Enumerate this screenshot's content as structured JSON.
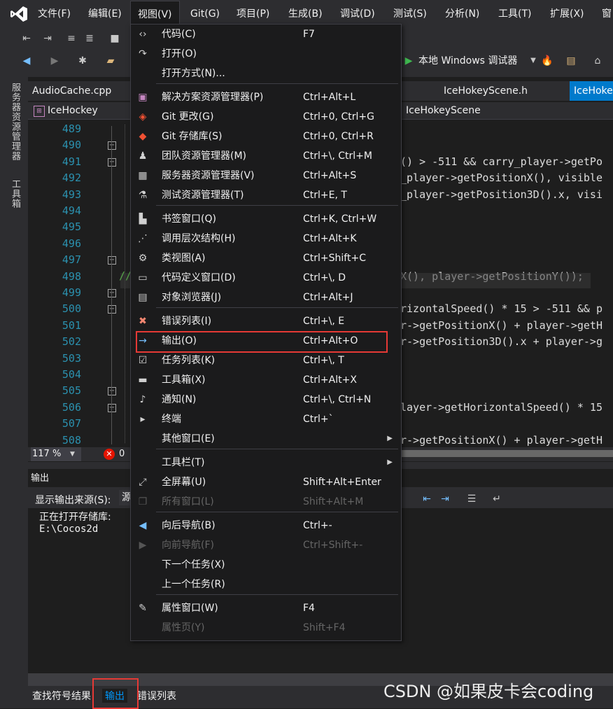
{
  "menubar": {
    "items": [
      "文件(F)",
      "编辑(E)",
      "视图(V)",
      "Git(G)",
      "项目(P)",
      "生成(B)",
      "调试(D)",
      "测试(S)",
      "分析(N)",
      "工具(T)",
      "扩展(X)",
      "窗"
    ]
  },
  "toolbar": {
    "debug_target": "本地 Windows 调试器"
  },
  "side_panels": [
    "服务器资源管理器",
    "工具箱"
  ],
  "editor": {
    "tabs": [
      "AudioCache.cpp",
      "IceHokeyScene.h",
      "IceHokey"
    ],
    "nav_left": "IceHockey",
    "nav_right": "IceHokeyScene",
    "line_numbers": [
      "489",
      "490",
      "491",
      "492",
      "493",
      "494",
      "495",
      "496",
      "497",
      "498",
      "499",
      "500",
      "501",
      "502",
      "503",
      "504",
      "505",
      "506",
      "507",
      "508"
    ],
    "code_lines": [
      "",
      "",
      "() > -511 && carry_player->getPo",
      "_player->getPositionX(), visible",
      "_player->getPosition3D().x, visi",
      "",
      "",
      "",
      "",
      "X(), player->getPositionY());",
      "",
      "rizontalSpeed() * 15 > -511 && p",
      "r->getPositionX() + player->getH",
      "r->getPosition3D().x + player->g",
      "",
      "",
      "",
      "layer->getHorizontalSpeed() * 15",
      "",
      "r->getPositionX() + player->getH"
    ],
    "comment_prefix": "//",
    "zoom": "117 %",
    "errors": "0"
  },
  "output_panel": {
    "title": "输出",
    "source_label": "显示输出来源(S):",
    "source_value": "源",
    "lines": [
      "正在打开存储库:",
      "E:\\Cocos2d"
    ]
  },
  "bottom_tabs": [
    "查找符号结果",
    "输出",
    "错误列表"
  ],
  "view_menu": {
    "items": [
      {
        "label": "代码(C)",
        "shortcut": "F7",
        "icon": "code-icon"
      },
      {
        "label": "打开(O)",
        "shortcut": "",
        "icon": "open-icon"
      },
      {
        "label": "打开方式(N)...",
        "shortcut": "",
        "icon": ""
      },
      {
        "label": "解决方案资源管理器(P)",
        "shortcut": "Ctrl+Alt+L",
        "icon": "solution-explorer-icon"
      },
      {
        "label": "Git 更改(G)",
        "shortcut": "Ctrl+0, Ctrl+G",
        "icon": "git-changes-icon"
      },
      {
        "label": "Git 存储库(S)",
        "shortcut": "Ctrl+0, Ctrl+R",
        "icon": "git-repository-icon"
      },
      {
        "label": "团队资源管理器(M)",
        "shortcut": "Ctrl+\\, Ctrl+M",
        "icon": "team-explorer-icon"
      },
      {
        "label": "服务器资源管理器(V)",
        "shortcut": "Ctrl+Alt+S",
        "icon": "server-explorer-icon"
      },
      {
        "label": "测试资源管理器(T)",
        "shortcut": "Ctrl+E, T",
        "icon": "test-explorer-icon"
      },
      {
        "label": "书签窗口(Q)",
        "shortcut": "Ctrl+K, Ctrl+W",
        "icon": "bookmark-icon"
      },
      {
        "label": "调用层次结构(H)",
        "shortcut": "Ctrl+Alt+K",
        "icon": "call-hierarchy-icon"
      },
      {
        "label": "类视图(A)",
        "shortcut": "Ctrl+Shift+C",
        "icon": "class-view-icon"
      },
      {
        "label": "代码定义窗口(D)",
        "shortcut": "Ctrl+\\, D",
        "icon": "code-definition-icon"
      },
      {
        "label": "对象浏览器(J)",
        "shortcut": "Ctrl+Alt+J",
        "icon": "object-browser-icon"
      },
      {
        "label": "错误列表(I)",
        "shortcut": "Ctrl+\\, E",
        "icon": "error-list-icon"
      },
      {
        "label": "输出(O)",
        "shortcut": "Ctrl+Alt+O",
        "icon": "output-icon"
      },
      {
        "label": "任务列表(K)",
        "shortcut": "Ctrl+\\, T",
        "icon": "task-list-icon"
      },
      {
        "label": "工具箱(X)",
        "shortcut": "Ctrl+Alt+X",
        "icon": "toolbox-icon"
      },
      {
        "label": "通知(N)",
        "shortcut": "Ctrl+\\, Ctrl+N",
        "icon": "bell-icon"
      },
      {
        "label": "终端",
        "shortcut": "Ctrl+`",
        "icon": "terminal-icon"
      },
      {
        "label": "其他窗口(E)",
        "shortcut": "",
        "icon": ""
      },
      {
        "label": "工具栏(T)",
        "shortcut": "",
        "icon": ""
      },
      {
        "label": "全屏幕(U)",
        "shortcut": "Shift+Alt+Enter",
        "icon": "fullscreen-icon"
      },
      {
        "label": "所有窗口(L)",
        "shortcut": "Shift+Alt+M",
        "icon": "all-windows-icon"
      },
      {
        "label": "向后导航(B)",
        "shortcut": "Ctrl+-",
        "icon": "back-icon"
      },
      {
        "label": "向前导航(F)",
        "shortcut": "Ctrl+Shift+-",
        "icon": "forward-icon"
      },
      {
        "label": "下一个任务(X)",
        "shortcut": "",
        "icon": ""
      },
      {
        "label": "上一个任务(R)",
        "shortcut": "",
        "icon": ""
      },
      {
        "label": "属性窗口(W)",
        "shortcut": "F4",
        "icon": "wrench-icon"
      },
      {
        "label": "属性页(Y)",
        "shortcut": "Shift+F4",
        "icon": ""
      }
    ]
  },
  "watermark": "CSDN @如果皮卡会coding",
  "colors": {
    "accent": "#007acc",
    "highlight": "#e53935",
    "menu_bg": "#1b1b1c",
    "chrome": "#2d2d30"
  }
}
